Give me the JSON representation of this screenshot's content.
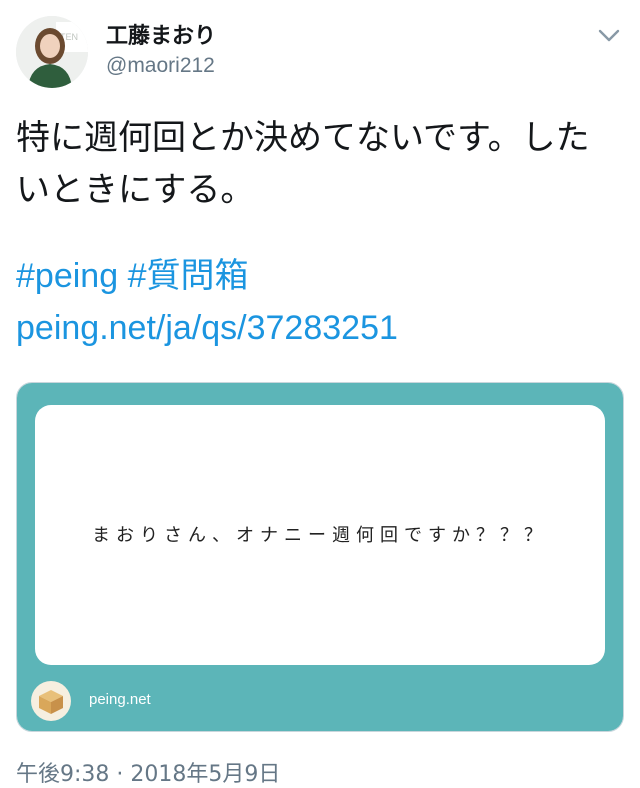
{
  "tweet": {
    "author": {
      "display_name": "工藤まおり",
      "handle": "@maori212",
      "avatar_icon": "profile-photo"
    },
    "menu_icon": "chevron-down-icon",
    "text_lines": [
      "特に週何回とか決めてないです。した",
      "いときにする。"
    ],
    "hashtags": [
      "#peing",
      "#質問箱"
    ],
    "link": "peing.net/ja/qs/37283251",
    "card": {
      "question": "まおりさん、オナニー週何回ですか？？？",
      "domain": "peing.net",
      "site_icon": "cardboard-box-icon",
      "accent_color": "#5cb5b8"
    },
    "timestamp": "午後9:38 · 2018年5月9日"
  }
}
